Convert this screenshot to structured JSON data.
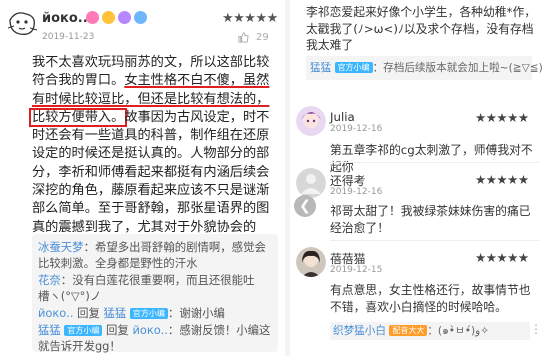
{
  "left": {
    "username": "йoко..",
    "rating": "★★★★★",
    "date": "2019-11-23",
    "likes": "29",
    "review": {
      "part1": "我不太喜欢玩玛丽苏的文，所以这部比较符合我的胃口。",
      "part2": "女主性格不白不傻，虽然有时候比较逗比，但还是比较有想法的，",
      "part3": "比较方便带入。",
      "part4": "故事因为古风设定，时不时还会有一些道具的科普，制作组在还原设定的时候还是挺认真的。人物部分的部分，李祈和师傅看起来都挺有内涵后续会深挖的角色，藤原看起来应该不只是谜渐部么简单。至于哥舒翰，那张星语界的图真的震撼到我了，尤其对于外貌协会的我，直接吹爆"
    },
    "replies": [
      {
        "name": "冰蚕天梦",
        "text": "：希望多出哥舒翰的剧情啊，感觉会比较刺激。全身都是野性的汗水"
      },
      {
        "name": "花奈",
        "text": "：没有白莲花很重要啊，而且还很能吐槽ヽ(°▽°)ノ"
      },
      {
        "name": "йoко..",
        "mid": " 回复 ",
        "target": "猛猛",
        "tag": "官方小编",
        "text": "：谢谢小编"
      },
      {
        "name": "猛猛",
        "tag": "官方小编",
        "mid": " 回复 ",
        "target": "йoко..",
        "text": "：感谢反馈！小编这就告诉开发gg！"
      }
    ]
  },
  "right": {
    "top_text": "李祁恋爱起来好像个小学生，各种幼稚*作，太戳我了(ﾉ>ω<)ﾉ以及求个存档，没有存档我太难了",
    "top_reply": {
      "name": "猛猛",
      "tag": "官方小编",
      "text": "：存档后续版本就会加上啦~(≧▽≦)/~"
    },
    "comments": [
      {
        "name": "Julia",
        "date": "2019-12-16",
        "rating": "★★★★★",
        "text": "第五章李祁的cg太刺激了，师傅我对不起你"
      },
      {
        "name": "还得考",
        "date": "2019-12-16",
        "rating": "★★★★★",
        "text": "祁哥太甜了！我被绿茶妹妹伤害的痛已经治愈了！"
      },
      {
        "name": "蓓蓓猫",
        "date": "2019-12-15",
        "rating": "★★★★★",
        "text": "有点意思，女主性格还行，故事情节也不错，喜欢小白摘怪的时候哈哈。"
      }
    ],
    "bottom_reply": {
      "name": "织梦猛小白",
      "tag": "配音大大",
      "text": "：(๑•̀ㅂ•́)و✧"
    },
    "more": "⋮"
  },
  "colors": {
    "underline": "#e02020",
    "link": "#4a8fd6",
    "tag_blue": "#3cb7ff",
    "tag_orange": "#ff9c2a",
    "tag_purple": "#9c6cf0"
  }
}
